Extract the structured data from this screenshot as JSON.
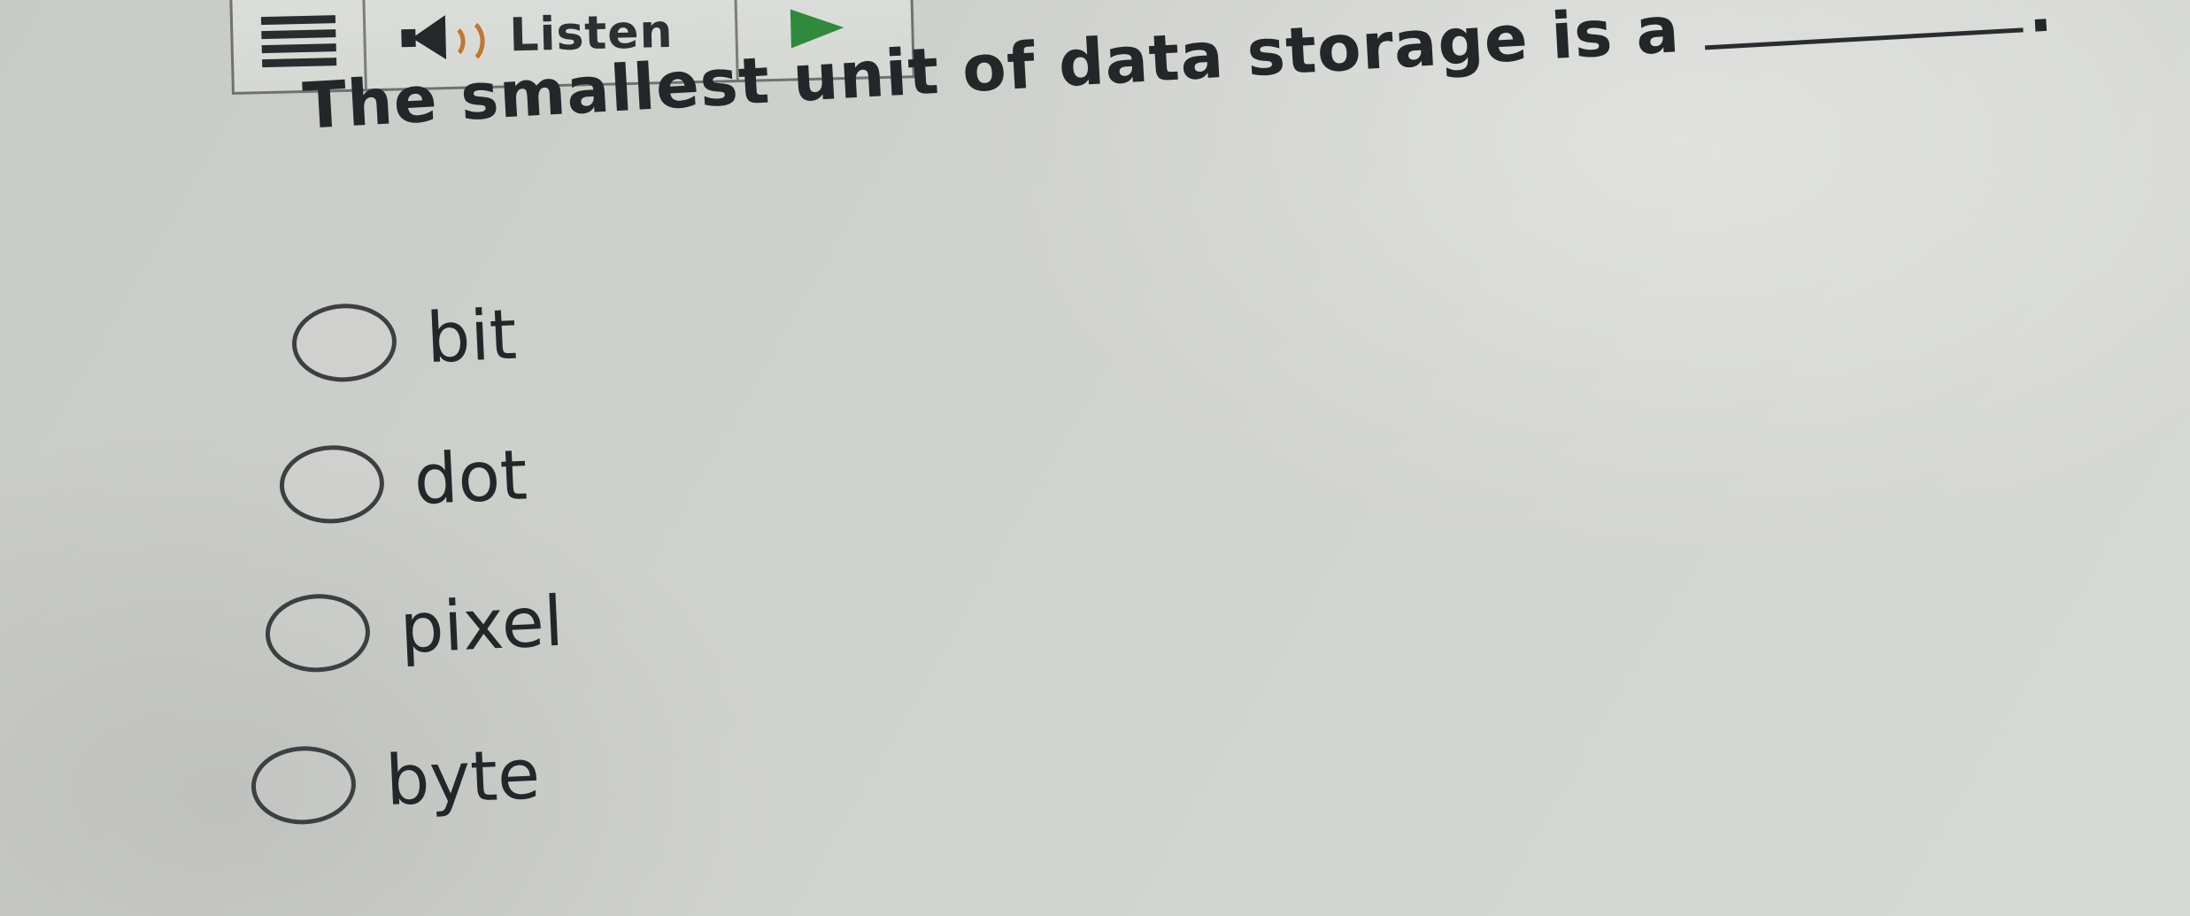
{
  "toolbar": {
    "menu_icon": "hamburger-menu-icon",
    "speaker_icon": "speaker-icon",
    "listen_label": "Listen",
    "play_icon": "play-icon",
    "colors": {
      "speaker_waves": "#c2762e",
      "play": "#2f8a3b"
    }
  },
  "question": {
    "text": "The smallest unit of data storage is a",
    "blank_end": "."
  },
  "options": [
    {
      "label": "bit",
      "selected": false
    },
    {
      "label": "dot",
      "selected": false
    },
    {
      "label": "pixel",
      "selected": false
    },
    {
      "label": "byte",
      "selected": false
    }
  ]
}
